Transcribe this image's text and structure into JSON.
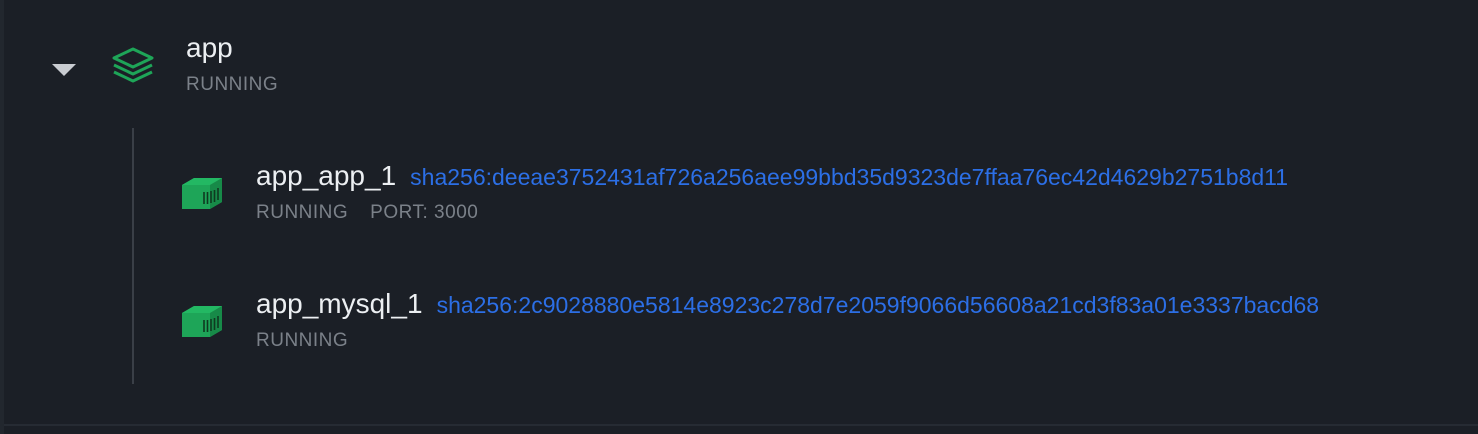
{
  "group": {
    "name": "app",
    "status": "RUNNING"
  },
  "containers": [
    {
      "name": "app_app_1",
      "id": "sha256:deeae3752431af726a256aee99bbd35d9323de7ffaa76ec42d4629b2751b8d11",
      "status": "RUNNING",
      "port": "PORT: 3000"
    },
    {
      "name": "app_mysql_1",
      "id": "sha256:2c9028880e5814e8923c278d7e2059f9066d56608a21cd3f83a01e3337bacd68",
      "status": "RUNNING"
    }
  ],
  "icons": {
    "toggle": "caret-down-icon",
    "group": "stack-layers-icon",
    "container": "container-box-icon"
  },
  "colors": {
    "background": "#1b1f26",
    "accent_green": "#1ea558",
    "link_blue": "#2c6fe6",
    "status_gray": "#7b8189",
    "text_primary": "#eceff2"
  }
}
